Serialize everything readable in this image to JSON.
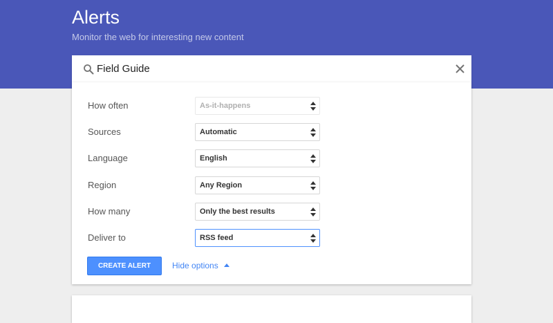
{
  "header": {
    "title": "Alerts",
    "subtitle": "Monitor the web for interesting new content"
  },
  "search": {
    "value": "Field Guide",
    "icon": "search-icon",
    "clear_icon": "close-icon"
  },
  "options": [
    {
      "label": "How often",
      "value": "As-it-happens",
      "state": "disabled"
    },
    {
      "label": "Sources",
      "value": "Automatic",
      "state": "normal"
    },
    {
      "label": "Language",
      "value": "English",
      "state": "normal"
    },
    {
      "label": "Region",
      "value": "Any Region",
      "state": "normal"
    },
    {
      "label": "How many",
      "value": "Only the best results",
      "state": "normal"
    },
    {
      "label": "Deliver to",
      "value": "RSS feed",
      "state": "focused"
    }
  ],
  "actions": {
    "create_label": "CREATE ALERT",
    "hide_options_label": "Hide options"
  },
  "colors": {
    "header_bg": "#4a57b8",
    "button_bg": "#4d90fe",
    "link": "#4285f4"
  }
}
